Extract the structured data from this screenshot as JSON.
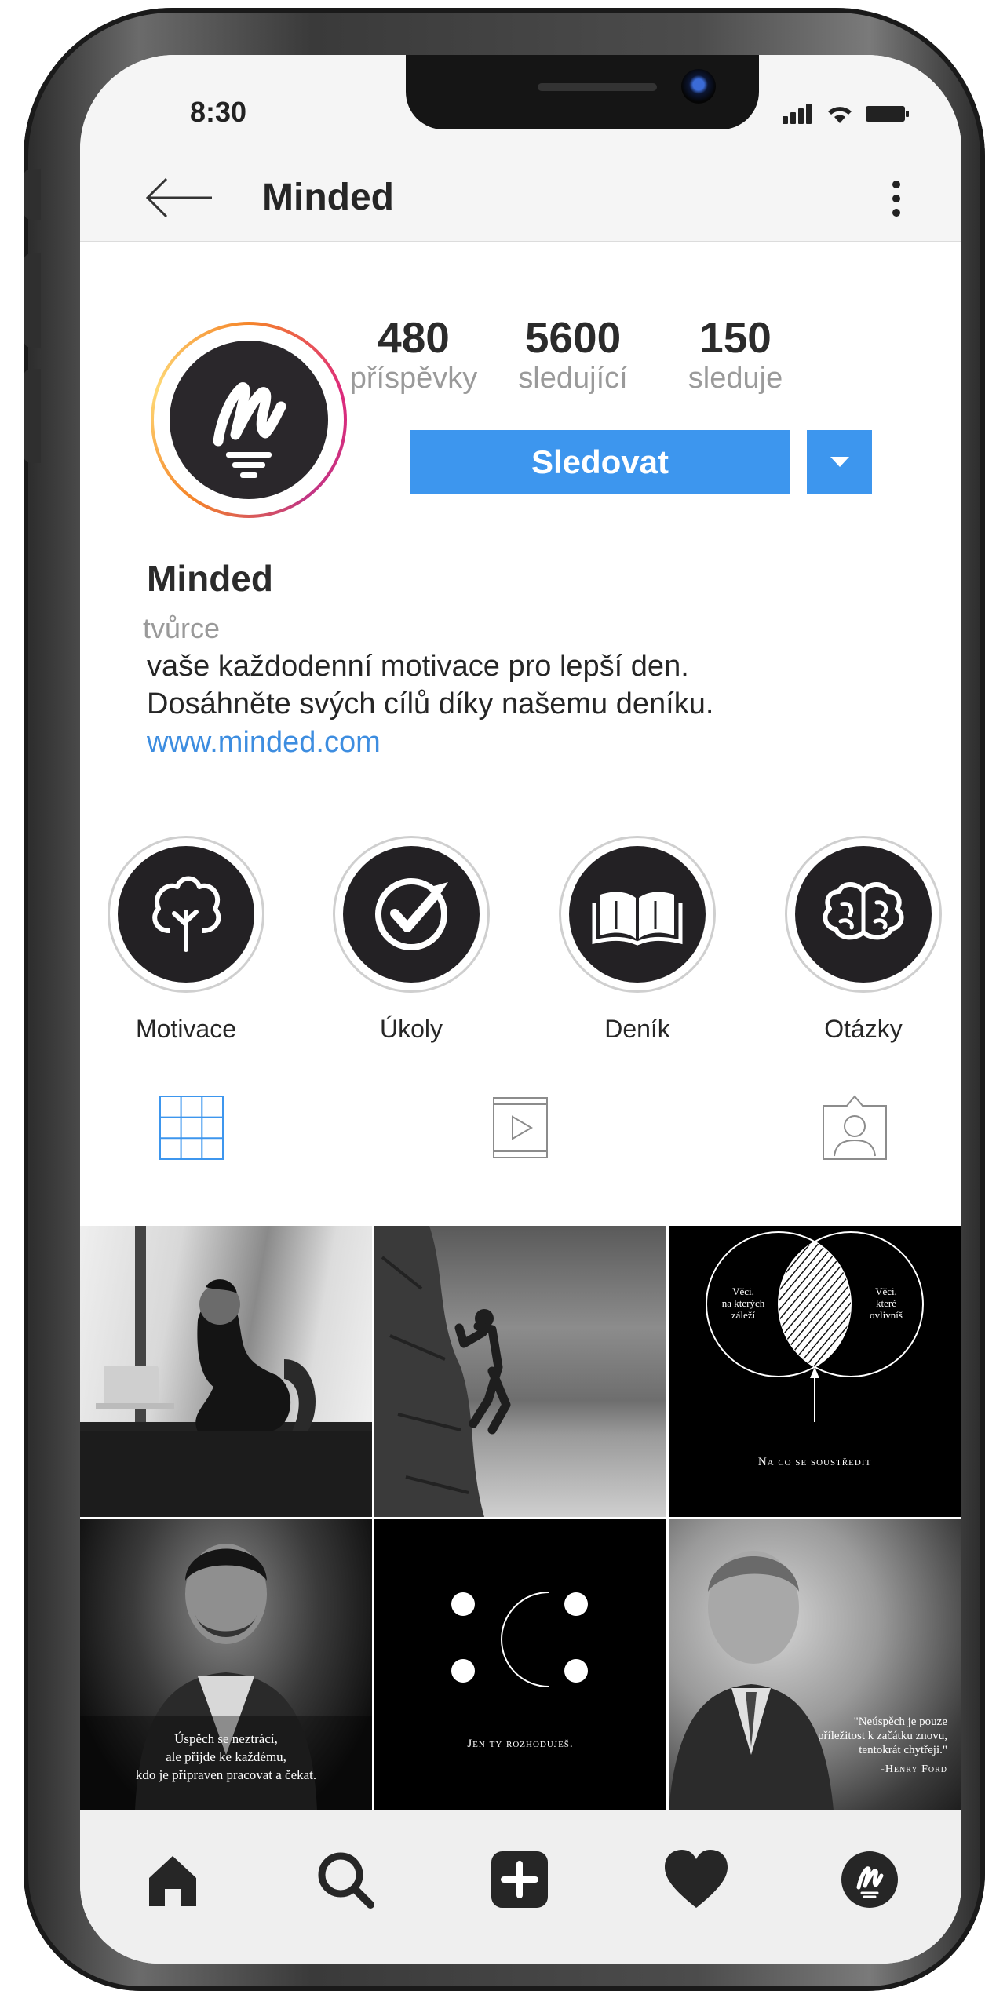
{
  "status": {
    "time": "8:30"
  },
  "header": {
    "title": "Minded"
  },
  "profile": {
    "stats": [
      {
        "value": "480",
        "label": "příspěvky"
      },
      {
        "value": "5600",
        "label": "sledující"
      },
      {
        "value": "150",
        "label": "sleduje"
      }
    ],
    "follow_label": "Sledovat",
    "name": "Minded",
    "category": "tvůrce",
    "bio_lines": [
      "vaše každodenní motivace pro lepší den.",
      "Dosáhněte svých cílů díky našemu deníku."
    ],
    "link": "www.minded.com"
  },
  "highlights": [
    {
      "label": "Motivace",
      "icon": "tree-icon"
    },
    {
      "label": "Úkoly",
      "icon": "check-icon"
    },
    {
      "label": "Deník",
      "icon": "book-icon"
    },
    {
      "label": "Otázky",
      "icon": "brain-icon"
    }
  ],
  "tabs": [
    {
      "icon": "grid-icon",
      "active": true
    },
    {
      "icon": "video-icon",
      "active": false
    },
    {
      "icon": "tagged-icon",
      "active": false
    }
  ],
  "posts": [
    {
      "type": "photo",
      "subject": "man-at-laptop"
    },
    {
      "type": "photo",
      "subject": "rock-climber"
    },
    {
      "type": "venn",
      "left_text": [
        "Věci,",
        "na kterých",
        "záleží"
      ],
      "right_text": [
        "Věci,",
        "které",
        "ovlivníš"
      ],
      "caption": "Na co se soustředit"
    },
    {
      "type": "quote-photo",
      "lines": [
        "Úspěch se neztrácí,",
        "ale přijde  ke každému,",
        "kdo je připraven pracovat a čekat."
      ]
    },
    {
      "type": "dots",
      "caption": "Jen ty rozhoduješ."
    },
    {
      "type": "quote-portrait",
      "lines": [
        "\"Neúspěch je pouze",
        "příležitost k začátku znovu,",
        "tentokrát chytřeji.\""
      ],
      "author": "-Henry Ford"
    }
  ],
  "colors": {
    "accent": "#3d96ee",
    "link": "#3d8de0",
    "dark": "#232124"
  }
}
